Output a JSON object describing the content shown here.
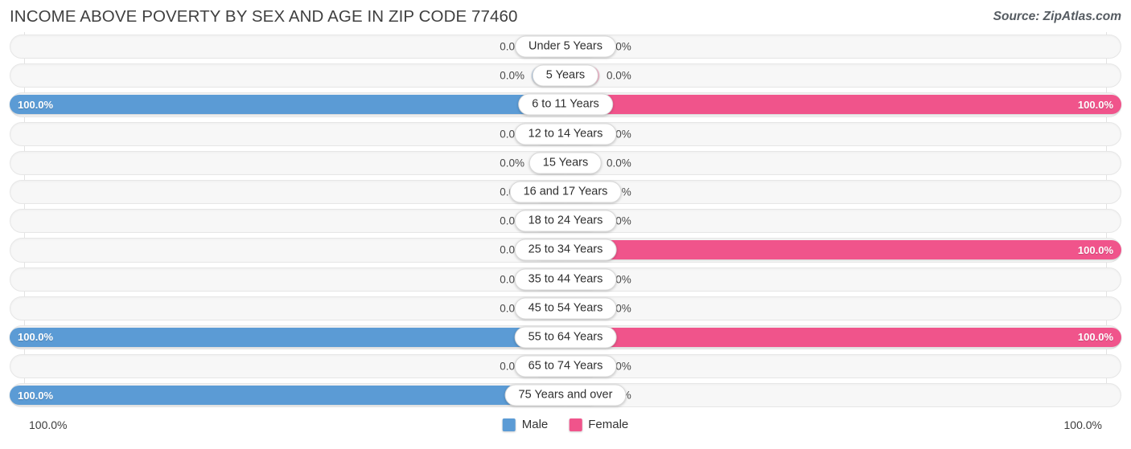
{
  "header": {
    "title": "INCOME ABOVE POVERTY BY SEX AND AGE IN ZIP CODE 77460",
    "source": "Source: ZipAtlas.com"
  },
  "legend": {
    "male_label": "Male",
    "female_label": "Female",
    "male_color": "#5b9bd5",
    "female_color": "#f0548b",
    "male_zero_color": "#aecbea",
    "female_zero_color": "#f9a8c4"
  },
  "axis": {
    "min_label": "100.0%",
    "max_label": "100.0%"
  },
  "chart_data": {
    "type": "bar",
    "title": "INCOME ABOVE POVERTY BY SEX AND AGE IN ZIP CODE 77460",
    "subtitle": "",
    "xlabel": "",
    "ylabel": "",
    "orientation": "horizontal-diverging",
    "grid": false,
    "legend_position": "bottom-center",
    "xlim": [
      0,
      100
    ],
    "axis_left_label": "100.0%",
    "axis_right_label": "100.0%",
    "categories": [
      "Under 5 Years",
      "5 Years",
      "6 to 11 Years",
      "12 to 14 Years",
      "15 Years",
      "16 and 17 Years",
      "18 to 24 Years",
      "25 to 34 Years",
      "35 to 44 Years",
      "45 to 54 Years",
      "55 to 64 Years",
      "65 to 74 Years",
      "75 Years and over"
    ],
    "series": [
      {
        "name": "Male",
        "side": "left",
        "color": "#5b9bd5",
        "values": [
          0.0,
          0.0,
          100.0,
          0.0,
          0.0,
          0.0,
          0.0,
          0.0,
          0.0,
          0.0,
          100.0,
          0.0,
          100.0
        ],
        "labels": [
          "0.0%",
          "0.0%",
          "100.0%",
          "0.0%",
          "0.0%",
          "0.0%",
          "0.0%",
          "0.0%",
          "0.0%",
          "0.0%",
          "100.0%",
          "0.0%",
          "100.0%"
        ]
      },
      {
        "name": "Female",
        "side": "right",
        "color": "#f0548b",
        "values": [
          0.0,
          0.0,
          100.0,
          0.0,
          0.0,
          0.0,
          0.0,
          100.0,
          0.0,
          0.0,
          100.0,
          0.0,
          0.0
        ],
        "labels": [
          "0.0%",
          "0.0%",
          "100.0%",
          "0.0%",
          "0.0%",
          "0.0%",
          "0.0%",
          "100.0%",
          "0.0%",
          "0.0%",
          "100.0%",
          "0.0%",
          "0.0%"
        ]
      }
    ]
  }
}
